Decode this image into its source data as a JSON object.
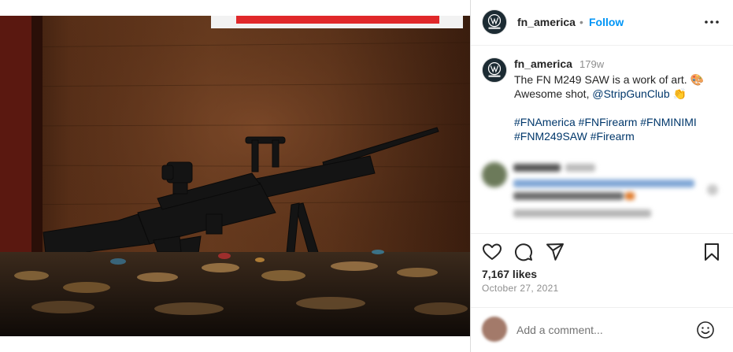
{
  "post": {
    "username": "fn_america",
    "follow_label": "Follow",
    "separator": "•",
    "caption": {
      "username": "fn_america",
      "age": "179w",
      "text_before": "The FN M249 SAW is a work of art. ",
      "emoji_art": "🎨",
      "text_middle": " Awesome shot, ",
      "mention": "@StripGunClub",
      "emoji_clap": "👏",
      "hashtags_line1": "#FNAmerica #FNFirearm #FNMINIMI",
      "hashtags_line2": "#FNM249SAW #Firearm"
    },
    "likes": "7,167 likes",
    "date": "October 27, 2021",
    "comment_placeholder": "Add a comment..."
  },
  "icons": [
    "fn-logo-icon",
    "more-options-icon",
    "like-heart-icon",
    "comment-icon",
    "share-icon",
    "save-bookmark-icon",
    "emoji-smile-icon"
  ],
  "colors": {
    "accent": "#0095f6",
    "mention": "#00376b",
    "muted": "#8e8e8e",
    "text": "#262626"
  }
}
